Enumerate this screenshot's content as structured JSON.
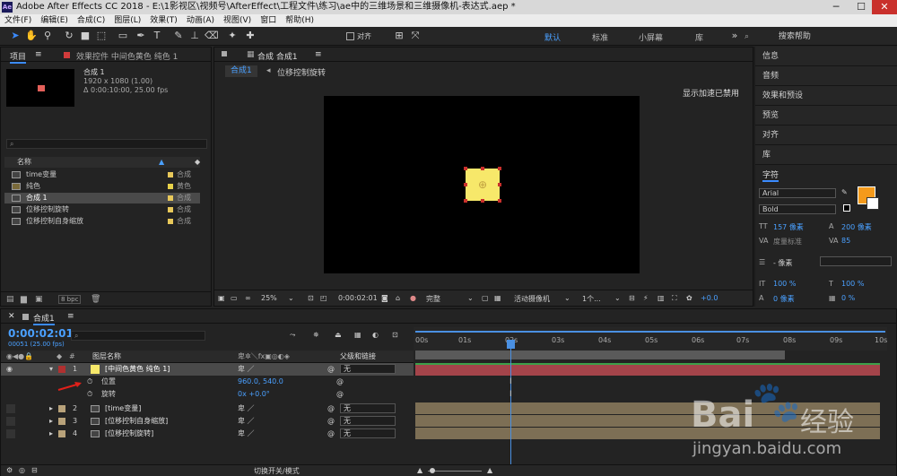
{
  "app": {
    "icon_text": "Ae",
    "title": "Adobe After Effects CC 2018 - E:\\1影视区\\视频号\\AfterEffect\\工程文件\\练习\\ae中的三维场景和三维摄像机-表达式.aep *"
  },
  "window": {
    "minimize": "─",
    "maximize": "☐",
    "close": "✕"
  },
  "menu": [
    "文件(F)",
    "编辑(E)",
    "合成(C)",
    "图层(L)",
    "效果(T)",
    "动画(A)",
    "视图(V)",
    "窗口",
    "帮助(H)"
  ],
  "toolbar": {
    "snap_label": "对齐",
    "workspaces": [
      "默认",
      "标准",
      "小屏幕",
      "库"
    ],
    "search_placeholder": "搜索帮助"
  },
  "project": {
    "tab": "项目",
    "effects_tab": "效果控件 中间色黄色 纯色 1",
    "comp_name": "合成 1",
    "comp_info1": "1920 x 1080 (1.00)",
    "comp_info2": "Δ 0:00:10:00, 25.00 fps",
    "col_name": "名称",
    "bpc": "8 bpc",
    "items": [
      {
        "name": "time变量",
        "color": "#e8c85a",
        "type": "合成"
      },
      {
        "name": "纯色",
        "color": "#e8d24a",
        "type": "黄色"
      },
      {
        "name": "合成 1",
        "color": "#e8c85a",
        "type": "合成"
      },
      {
        "name": "位移控制旋转",
        "color": "#e8c85a",
        "type": "合成"
      },
      {
        "name": "位移控制自身缩放",
        "color": "#e8c85a",
        "type": "合成"
      }
    ]
  },
  "comp_viewer": {
    "tab": "合成 合成1",
    "breadcrumb1": "合成1",
    "breadcrumb2": "位移控制旋转",
    "accel_note": "显示加速已禁用",
    "zoom": "25%",
    "timecode": "0:00:02:01",
    "quality": "完整",
    "camera": "活动摄像机",
    "views": "1个...",
    "exposure": "+0.0"
  },
  "right_panels": [
    "信息",
    "音频",
    "效果和预设",
    "预览",
    "对齐",
    "库"
  ],
  "character": {
    "tab": "字符",
    "font": "Arial",
    "style": "Bold",
    "size": "157 像素",
    "leading": "200 像素",
    "tracking": "度量标准",
    "kerning": "85",
    "stroke_unit": "- 像素",
    "vscale": "100 %",
    "hscale": "100 %",
    "baseline": "0 像素",
    "tsume": "0 %",
    "fill_color": "#f59a1b"
  },
  "timeline": {
    "tab": "合成1",
    "timecode": "0:00:02:01",
    "frame_info": "00051 (25.00 fps)",
    "col_layer": "图层名称",
    "col_parent": "父级和链接",
    "toggle_label": "切换开关/模式",
    "ruler": [
      "00s",
      "01s",
      "02s",
      "03s",
      "04s",
      "05s",
      "06s",
      "07s",
      "08s",
      "09s",
      "10s"
    ],
    "layers": [
      {
        "num": "1",
        "name": "[中间色黄色 纯色 1]",
        "color": "#b03030",
        "parent": "无"
      },
      {
        "num": "2",
        "name": "[time变量]",
        "color": "#b8a27a",
        "parent": "无"
      },
      {
        "num": "3",
        "name": "[位移控制自身缩放]",
        "color": "#b8a27a",
        "parent": "无"
      },
      {
        "num": "4",
        "name": "[位移控制旋转]",
        "color": "#b8a27a",
        "parent": "无"
      }
    ],
    "props": [
      {
        "name": "位置",
        "value": "960.0, 540.0"
      },
      {
        "name": "旋转",
        "value": "0x +0.0°"
      }
    ]
  },
  "watermark": {
    "brand": "Bai",
    "brand2": "经验",
    "url": "jingyan.baidu.com"
  }
}
